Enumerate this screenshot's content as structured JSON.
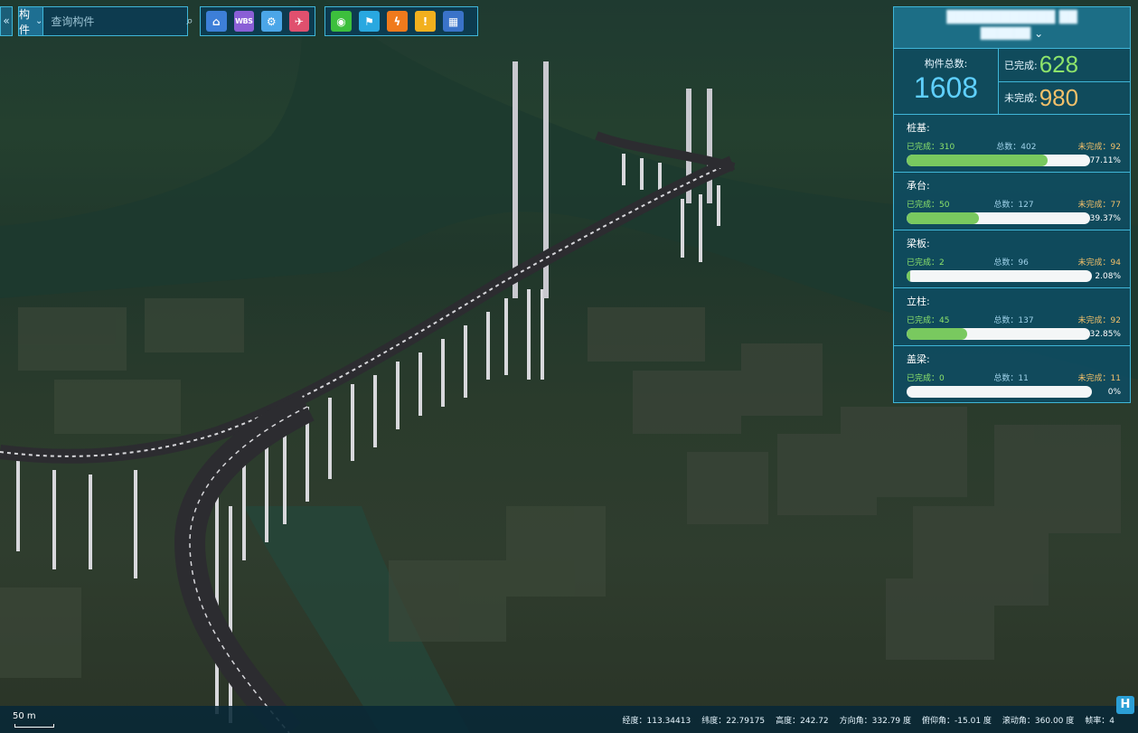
{
  "search": {
    "collapse_label": "«",
    "type_label": "构件",
    "placeholder": "查询构件"
  },
  "toolbar": {
    "group1": [
      {
        "icon": "home-icon",
        "glyph": "⌂",
        "color": "#3d7fd8"
      },
      {
        "icon": "wbs-icon",
        "glyph": "WBS",
        "color": "#8a5fd6"
      },
      {
        "icon": "settings-icon",
        "glyph": "⚙",
        "color": "#4ba6e8"
      },
      {
        "icon": "flight-icon",
        "glyph": "✈",
        "color": "#e0506e"
      }
    ],
    "group2": [
      {
        "icon": "location-icon",
        "glyph": "◉",
        "color": "#3dbf3d"
      },
      {
        "icon": "flag-icon",
        "glyph": "⚑",
        "color": "#29a8e0"
      },
      {
        "icon": "lightning-icon",
        "glyph": "ϟ",
        "color": "#f07a1c"
      },
      {
        "icon": "warning-icon",
        "glyph": "!",
        "color": "#f2b01e"
      },
      {
        "icon": "layout-icon",
        "glyph": "▦",
        "color": "#3a73c9"
      }
    ]
  },
  "panel": {
    "title": "████████████ ██",
    "subtitle": "██████",
    "total_label": "构件总数:",
    "total": "1608",
    "done_label": "已完成:",
    "done": "628",
    "todo_label": "未完成:",
    "todo": "980",
    "categories": [
      {
        "name": "桩基:",
        "done_text": "已完成：310",
        "total_text": "总数：402",
        "todo_text": "未完成：92",
        "percent": "77.11%",
        "fraction": 0.7711
      },
      {
        "name": "承台:",
        "done_text": "已完成：50",
        "total_text": "总数：127",
        "todo_text": "未完成：77",
        "percent": "39.37%",
        "fraction": 0.3937
      },
      {
        "name": "梁板:",
        "done_text": "已完成：2",
        "total_text": "总数：96",
        "todo_text": "未完成：94",
        "percent": "2.08%",
        "fraction": 0.0208
      },
      {
        "name": "立柱:",
        "done_text": "已完成：45",
        "total_text": "总数：137",
        "todo_text": "未完成：92",
        "percent": "32.85%",
        "fraction": 0.3285
      },
      {
        "name": "盖梁:",
        "done_text": "已完成：0",
        "total_text": "总数：11",
        "todo_text": "未完成：11",
        "percent": "0%",
        "fraction": 0
      }
    ]
  },
  "status": {
    "scale": "50 m",
    "longitude": "经度：113.34413",
    "latitude": "纬度：22.79175",
    "height": "高度：242.72",
    "heading": "方向角：332.79 度",
    "pitch": "俯仰角：-15.01 度",
    "roll": "滚动角：360.00 度",
    "fps": "帧率：4"
  },
  "colors": {
    "panel_bg": "#0c4e66",
    "accent_border": "#3fb6d8",
    "progress": "#79c95f",
    "done": "#8de36b",
    "todo": "#f2c06a",
    "total": "#5fd0ff"
  }
}
